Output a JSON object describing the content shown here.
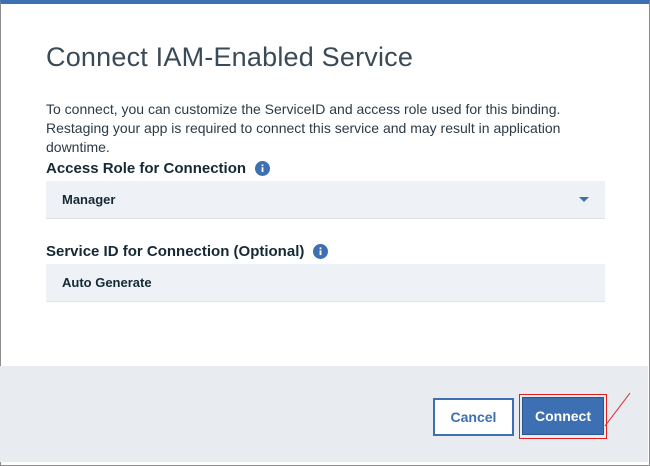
{
  "dialog": {
    "title": "Connect IAM-Enabled Service",
    "description": "To connect, you can customize the ServiceID and access role used for this binding. Restaging your app is required to connect this service and may result in application downtime."
  },
  "access_role": {
    "label": "Access Role for Connection",
    "value": "Manager",
    "info_icon": "info-icon"
  },
  "service_id": {
    "label": "Service ID for Connection (Optional)",
    "value": "Auto Generate",
    "info_icon": "info-icon"
  },
  "actions": {
    "cancel_label": "Cancel",
    "connect_label": "Connect"
  },
  "colors": {
    "accent": "#3d70b2",
    "highlight": "#e02020",
    "footer_bg": "#e8ebef",
    "field_bg": "#eef2f6"
  }
}
